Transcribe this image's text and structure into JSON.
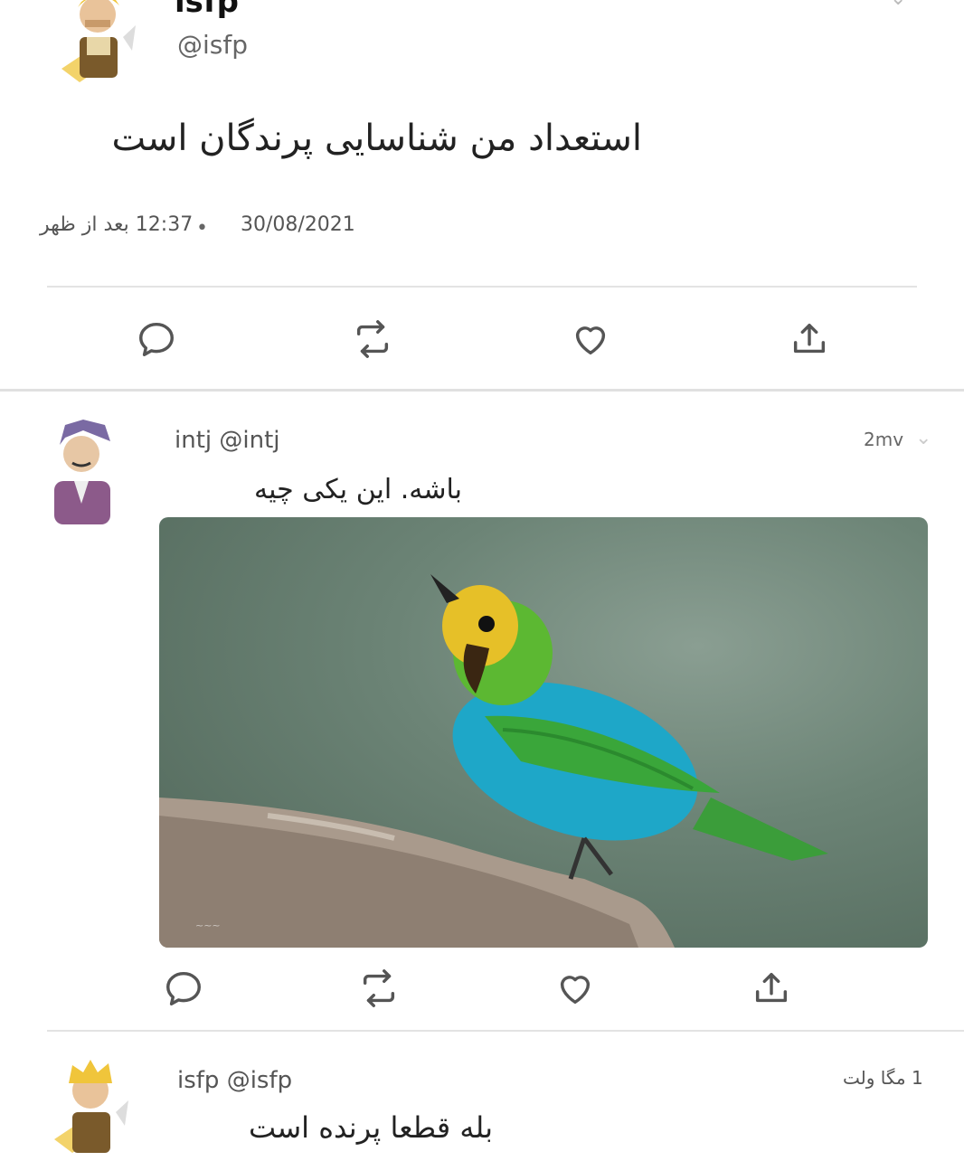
{
  "tweet": {
    "author_name": "isfp",
    "author_handle": "@isfp",
    "text": "استعداد من شناسایی پرندگان است",
    "time": "12:37 بعد از ظهر",
    "date": "30/08/2021",
    "dot": "•"
  },
  "reply": {
    "author": "intj @intj",
    "time": "2mv",
    "text": "باشه. این یکی چیه",
    "image_icon": "bird-photo"
  },
  "reply2": {
    "author": "isfp @isfp",
    "time": "1 مگا ولت",
    "text": "بله قطعا پرنده است"
  },
  "icons": {
    "reply": "speech-bubble-icon",
    "retweet": "retweet-icon",
    "like": "heart-icon",
    "share": "share-icon"
  },
  "colors": {
    "icon": "#555555",
    "divider": "#e3e3e3"
  }
}
